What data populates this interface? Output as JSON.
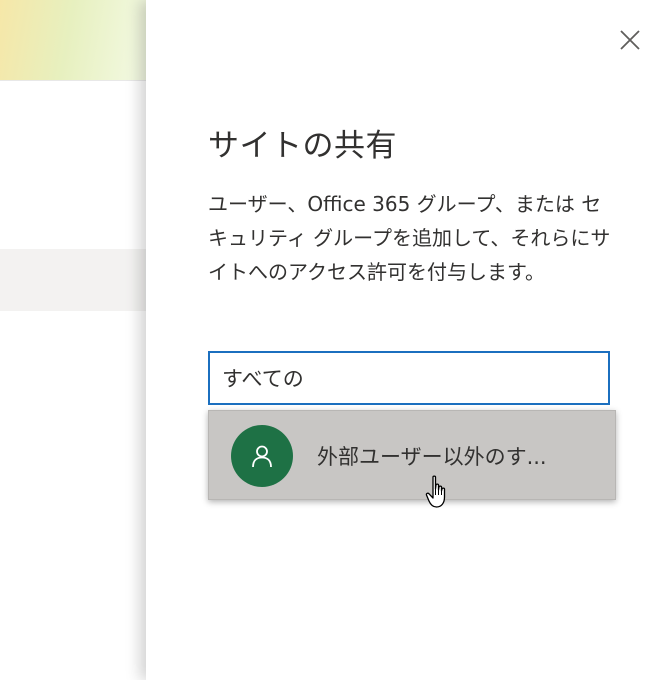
{
  "panel": {
    "title": "サイトの共有",
    "description": "ユーザー、Office 365 グループ、または セキュリティ グループを追加して、それらにサイトへのアクセス許可を付与します。",
    "close_icon": "close-icon"
  },
  "search": {
    "value": "すべての"
  },
  "suggestions": [
    {
      "label": "外部ユーザー以外のす...",
      "avatar_icon": "person-icon",
      "avatar_color": "#1e7145"
    }
  ],
  "colors": {
    "input_border": "#1b6fbf",
    "dropdown_bg": "#c8c6c4",
    "avatar": "#1e7145"
  }
}
